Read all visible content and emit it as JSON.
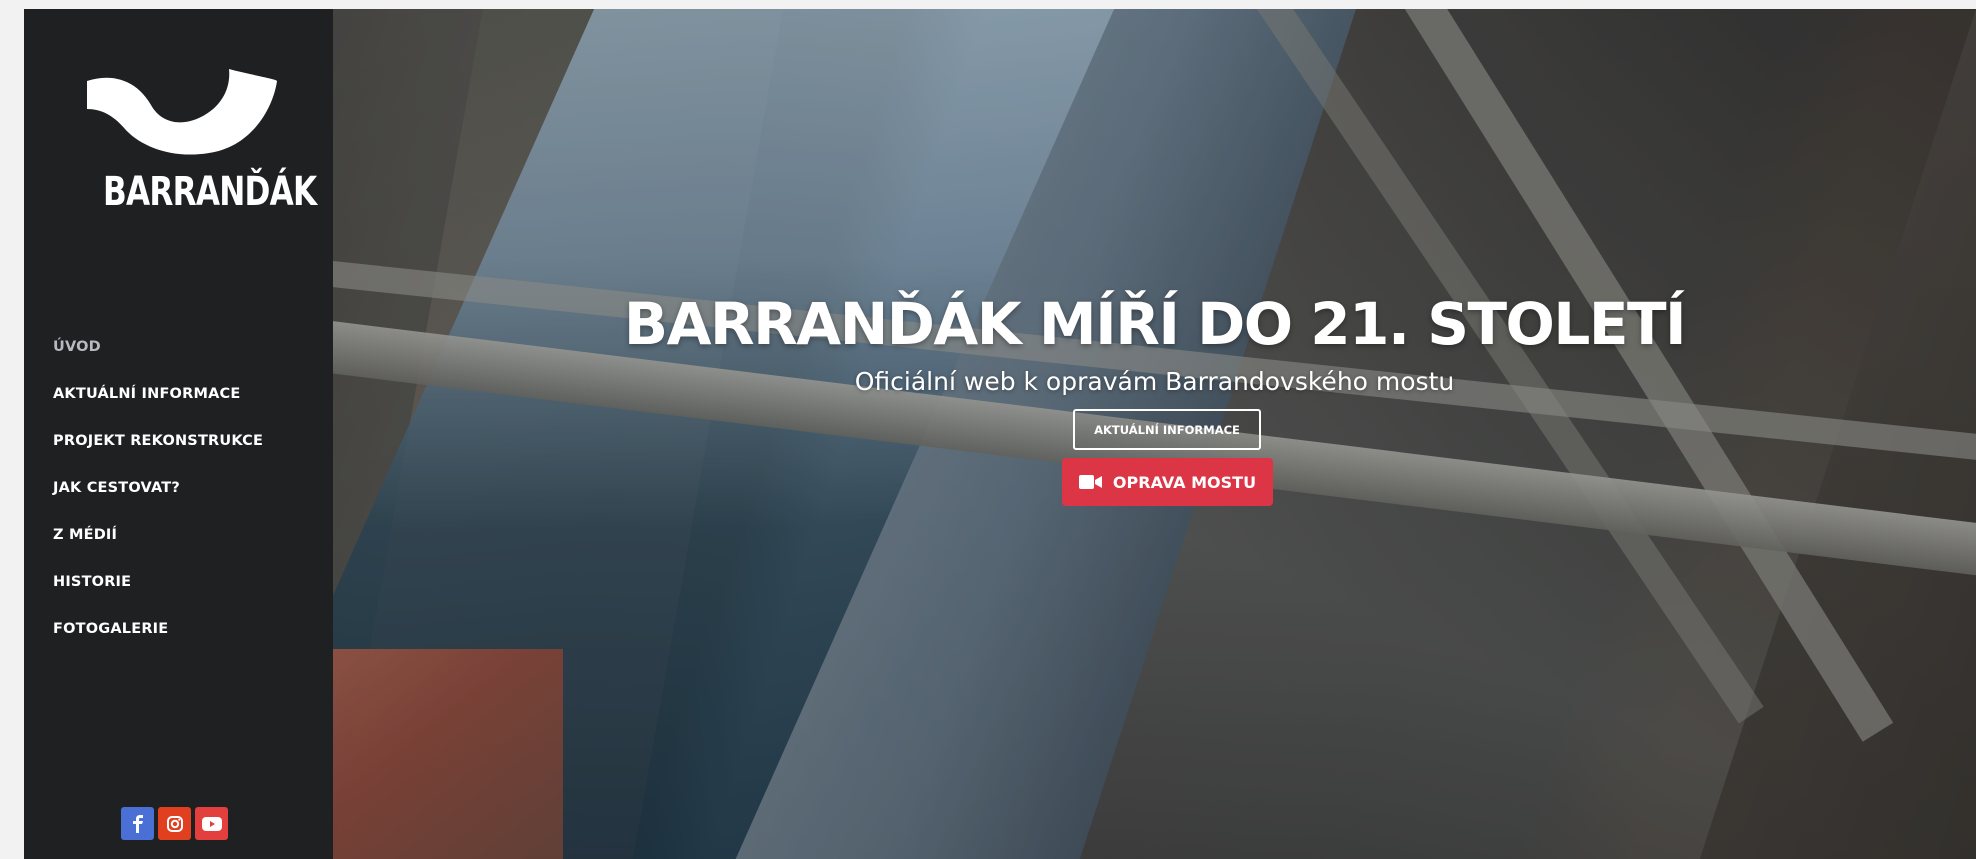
{
  "brand": {
    "logo_icon": "barrandak-wave-logo",
    "logo_text": "BARRANĎÁK"
  },
  "nav": {
    "items": [
      {
        "label": "ÚVOD",
        "active": true
      },
      {
        "label": "AKTUÁLNÍ INFORMACE",
        "active": false
      },
      {
        "label": "PROJEKT REKONSTRUKCE",
        "active": false
      },
      {
        "label": "JAK CESTOVAT?",
        "active": false
      },
      {
        "label": "Z MÉDIÍ",
        "active": false
      },
      {
        "label": "HISTORIE",
        "active": false
      },
      {
        "label": "FOTOGALERIE",
        "active": false
      }
    ]
  },
  "social": [
    {
      "icon": "facebook-icon",
      "color": "#4a70d6"
    },
    {
      "icon": "instagram-icon",
      "color": "#e0401f"
    },
    {
      "icon": "youtube-icon",
      "color": "#e43f3f"
    }
  ],
  "hero": {
    "title": "BARRANĎÁK MÍŘÍ DO 21. STOLETÍ",
    "subtitle": "Oficiální web k opravám Barrandovského mostu",
    "primary_button": "AKTUÁLNÍ INFORMACE",
    "video_button": "OPRAVA MOSTU",
    "video_button_icon": "video-camera-icon",
    "background_image": "aerial-bridge-river-photo"
  },
  "colors": {
    "sidebar_bg": "#1f2022",
    "accent_red": "#dc3545",
    "nav_active": "#b9b9c0"
  }
}
